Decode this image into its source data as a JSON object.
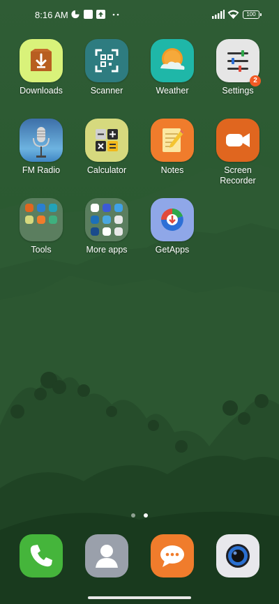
{
  "status_bar": {
    "time": "8:16 AM",
    "battery": "100"
  },
  "apps": [
    {
      "label": "Downloads",
      "icon": "download-box-icon",
      "color": "#d9f27a"
    },
    {
      "label": "Scanner",
      "icon": "qr-scanner-icon",
      "color": "#2e7c80"
    },
    {
      "label": "Weather",
      "icon": "sun-cloud-icon",
      "color": "#1fb7a8"
    },
    {
      "label": "Settings",
      "icon": "sliders-icon",
      "color": "#e6e6e6",
      "badge": "2"
    },
    {
      "label": "FM Radio",
      "icon": "microphone-icon",
      "color": "#3f86c4"
    },
    {
      "label": "Calculator",
      "icon": "calculator-icon",
      "color": "#d6d97e"
    },
    {
      "label": "Notes",
      "icon": "notepad-pencil-icon",
      "color": "#f07c2c"
    },
    {
      "label": "Screen Recorder",
      "label_line1": "Screen",
      "label_line2": "Recorder",
      "icon": "video-camera-icon",
      "color": "#e0661f"
    },
    {
      "label": "Tools",
      "icon": "folder-icon"
    },
    {
      "label": "More apps",
      "icon": "folder-icon"
    },
    {
      "label": "GetApps",
      "icon": "getapps-icon",
      "color": "#8fa7e8"
    }
  ],
  "page_indicator": {
    "pages": 2,
    "current": 2
  },
  "dock": [
    {
      "name": "Phone",
      "icon": "phone-icon",
      "color": "#45b53b"
    },
    {
      "name": "Contacts",
      "icon": "contact-icon",
      "color": "#9aa0ab"
    },
    {
      "name": "Messaging",
      "icon": "chat-bubble-icon",
      "color": "#f07c2c"
    },
    {
      "name": "Camera",
      "icon": "camera-lens-icon",
      "color": "#e8e8ec"
    }
  ]
}
